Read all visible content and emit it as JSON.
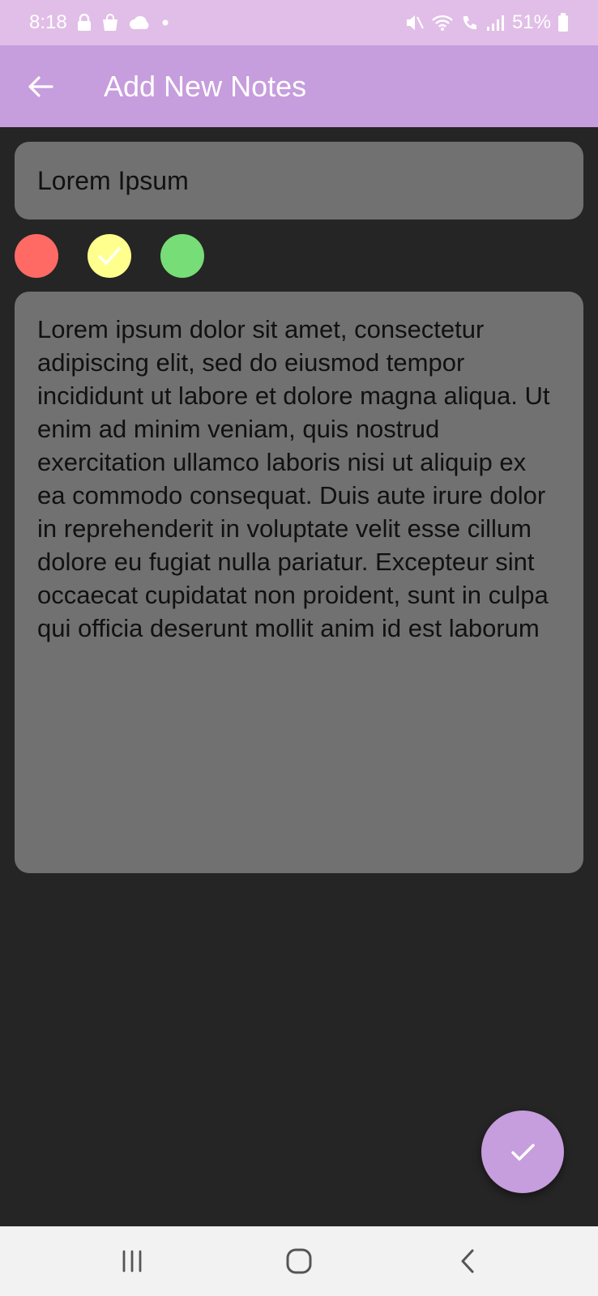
{
  "status_bar": {
    "time": "8:18",
    "left_icons": [
      "lock-icon",
      "bag-icon",
      "cloud-icon",
      "dot-icon"
    ],
    "right_icons": [
      "mute-icon",
      "wifi-icon",
      "call-icon",
      "signal-icon",
      "battery-icon"
    ],
    "battery": "51%"
  },
  "app_bar": {
    "title": "Add New Notes",
    "back_icon": "arrow-left-icon"
  },
  "note": {
    "title_value": "Lorem Ipsum",
    "body_value": "Lorem ipsum dolor sit amet, consectetur adipiscing elit, sed do eiusmod tempor incididunt ut labore et dolore magna aliqua. Ut enim ad minim veniam, quis nostrud exercitation ullamco laboris nisi ut aliquip ex ea commodo consequat. Duis aute irure dolor in reprehenderit in voluptate velit esse cillum dolore eu fugiat nulla pariatur. Excepteur sint occaecat cupidatat non proident, sunt in culpa qui officia deserunt mollit anim id est laborum"
  },
  "colors": {
    "options": [
      {
        "name": "red",
        "hex": "#FF6B64",
        "selected": false
      },
      {
        "name": "yellow",
        "hex": "#FFFF8D",
        "selected": true
      },
      {
        "name": "green",
        "hex": "#77DD77",
        "selected": false
      }
    ]
  },
  "fab": {
    "icon": "check-icon"
  },
  "theme": {
    "status_bar": "#E1BEE7",
    "app_bar": "#C69DDD",
    "background": "#252525",
    "field": "#717171",
    "nav_bar": "#F2F2F2"
  },
  "nav_bar": {
    "icons": [
      "recent-apps-icon",
      "home-icon",
      "back-icon"
    ]
  }
}
